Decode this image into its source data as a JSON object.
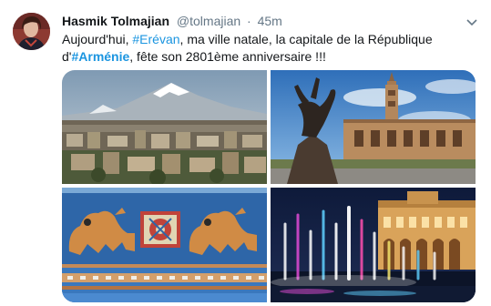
{
  "tweet": {
    "author_name": "Hasmik Tolmajian",
    "author_handle": "@tolmajian",
    "separator": "·",
    "time": "45m",
    "text_line1_pre": "Aujourd'hui, ",
    "hashtag1": "#Erévan",
    "text_line1_post": ", ma ville natale, la capitale de la République",
    "text_line2_pre": "d'",
    "hashtag2": "#Arménie",
    "text_line2_post": ", fête son 2801ème anniversaire !!!"
  },
  "icons": {
    "avatar": "avatar-photo",
    "menu": "chevron-down-icon"
  },
  "colors": {
    "hashtag": "#1b95e0",
    "meta": "#657786",
    "text": "#14171a"
  }
}
